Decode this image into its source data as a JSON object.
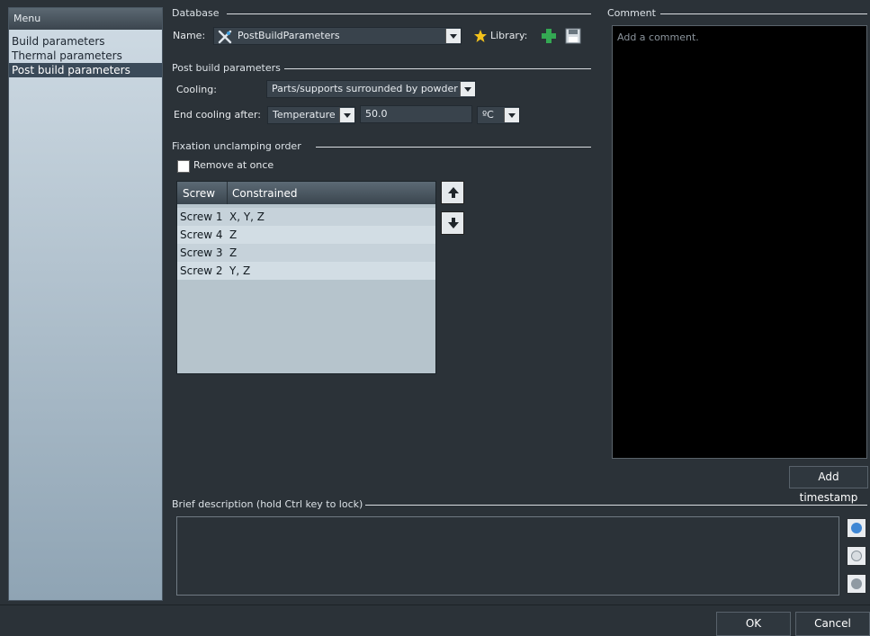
{
  "sidebar": {
    "header": "Menu",
    "items": [
      {
        "label": "Build parameters"
      },
      {
        "label": "Thermal parameters"
      },
      {
        "label": "Post build parameters"
      }
    ]
  },
  "database": {
    "title": "Database",
    "name_label": "Name:",
    "name_value": "PostBuildParameters",
    "library_label": "Library:"
  },
  "post_build": {
    "title": "Post build parameters",
    "cooling_label": "Cooling:",
    "cooling_value": "Parts/supports surrounded by powder",
    "end_cooling_label": "End cooling after:",
    "end_cooling_mode": "Temperature",
    "end_cooling_value": "50.0",
    "end_cooling_unit": "ºC"
  },
  "fixation": {
    "title": "Fixation unclamping order",
    "remove_at_once_label": "Remove at once",
    "columns": [
      "Screw",
      "Constrained"
    ],
    "rows": [
      [
        "Screw 1",
        "X, Y, Z"
      ],
      [
        "Screw 4",
        "Z"
      ],
      [
        "Screw 3",
        "Z"
      ],
      [
        "Screw 2",
        "Y, Z"
      ]
    ]
  },
  "comment": {
    "title": "Comment",
    "placeholder": "Add a comment.",
    "add_timestamp_label": "Add timestamp"
  },
  "brief_description": {
    "title": "Brief description (hold Ctrl key to lock)"
  },
  "footer": {
    "ok_label": "OK",
    "cancel_label": "Cancel"
  },
  "colors": {
    "accent": "#3a4a59",
    "star": "#f3c21b",
    "plus": "#34a853",
    "info": "#3f87d4"
  },
  "icons": [
    "tools-icon",
    "star-icon",
    "plus-icon",
    "save-icon",
    "arrow-up-icon",
    "arrow-down-icon",
    "info-icon",
    "add-icon",
    "next-icon"
  ]
}
